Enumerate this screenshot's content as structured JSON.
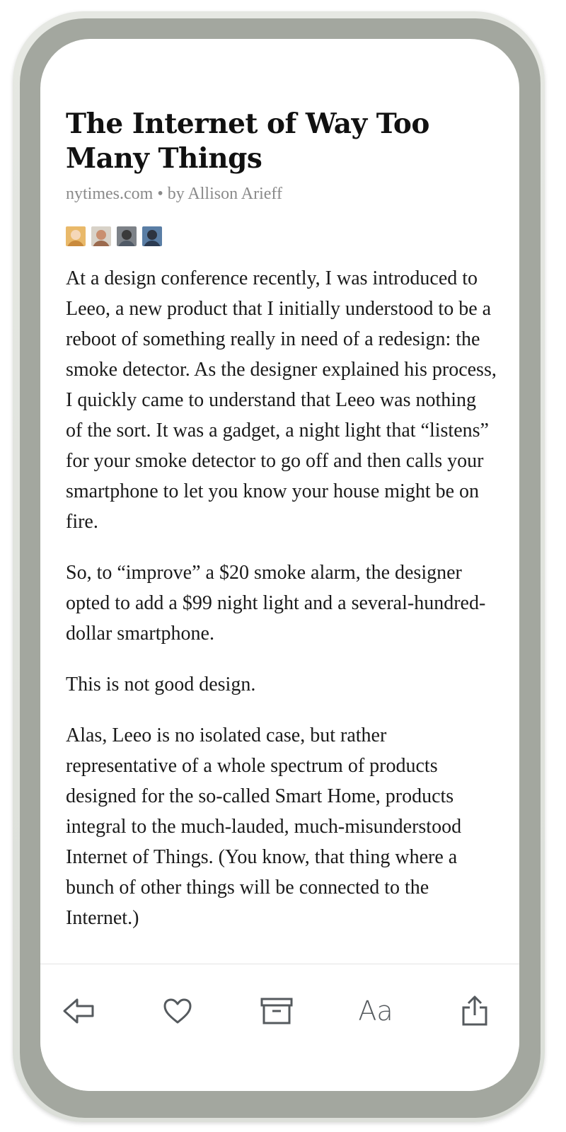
{
  "article": {
    "title_line1": "The Internet of Way Too",
    "title_line2": "Many Things",
    "meta": "nytimes.com • by Allison Arieff",
    "paragraphs": [
      "At a design conference recently, I was introduced to Leeo, a new product that I initially understood to be a reboot of something really in need of a redesign: the smoke detector. As the designer explained his process, I quickly came to understand that Leeo was nothing of the sort. It was a gadget, a night light that “listens” for your smoke detector to go off and then calls your smartphone to let you know your house might be on fire.",
      "So, to “improve” a $20 smoke alarm, the designer opted to add a $99 night light and a several-hundred-dollar smartphone.",
      "This is not good design.",
      "Alas, Leeo is no isolated case, but rather representative of a whole spectrum of products designed for the so-called Smart Home, products integral to the much-lauded, much-misunderstood Internet of Things. (You know, that thing where a bunch of other things will be connected to the Internet.)"
    ]
  },
  "avatars": [
    "avatar-1",
    "avatar-2",
    "avatar-3",
    "avatar-4"
  ],
  "toolbar": {
    "back_icon": "back-arrow-icon",
    "like_icon": "heart-icon",
    "archive_icon": "archive-box-icon",
    "font_label": "Aa",
    "share_icon": "share-icon"
  },
  "colors": {
    "frame": "#a3a79f",
    "text": "#1a1a1a",
    "meta": "#8a8a8a",
    "icon": "#555a5e"
  }
}
